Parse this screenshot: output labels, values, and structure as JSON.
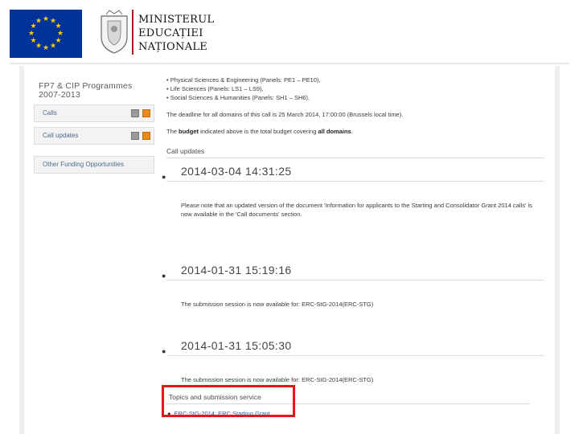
{
  "header": {
    "ministry_lines": [
      "MINISTERUL",
      "EDUCAȚIEI",
      "NAȚIONALE"
    ]
  },
  "sidebar": {
    "programmes_title_line1": "FP7 & CIP Programmes",
    "programmes_title_line2": "2007-2013",
    "items": [
      {
        "label": "Calls"
      },
      {
        "label": "Call updates"
      }
    ],
    "other_funding_label": "Other Funding Opportunities"
  },
  "main": {
    "domain_bullets": [
      "• Physical Sciences & Engineering (Panels: PE1 – PE10),",
      "• Life Sciences (Panels: LS1 – LS9),",
      "• Social Sciences & Humanities (Panels: SH1 – SH6)."
    ],
    "deadline_text": "The deadline for all domains of this call is 25 March 2014, 17:00:00 (Brussels local time).",
    "budget_prefix": "The ",
    "budget_bold1": "budget",
    "budget_middle": " indicated above is the total budget covering ",
    "budget_bold2": "all domains",
    "budget_suffix": ".",
    "call_updates_heading": "Call updates",
    "updates": [
      {
        "date": "2014-03-04 14:31:25",
        "text": "Please note that an updated version of the document 'Information for applicants to the Starting and Consolidator Grant 2014 calls' is now available in the 'Call documents' section."
      },
      {
        "date": "2014-01-31 15:19:16",
        "text": "The submission session is now available for: ERC-StG-2014(ERC-STG)"
      },
      {
        "date": "2014-01-31 15:05:30",
        "text": "The submission session is now available for: ERC-StG-2014(ERC-STG)"
      }
    ],
    "topics_heading": "Topics and submission service",
    "topics_link": "ERC-StG-2014: ERC Starting Grant"
  },
  "colors": {
    "highlight_border": "#e8141a",
    "eu_blue": "#003399",
    "eu_star": "#ffcc00",
    "link": "#2a5db0"
  }
}
